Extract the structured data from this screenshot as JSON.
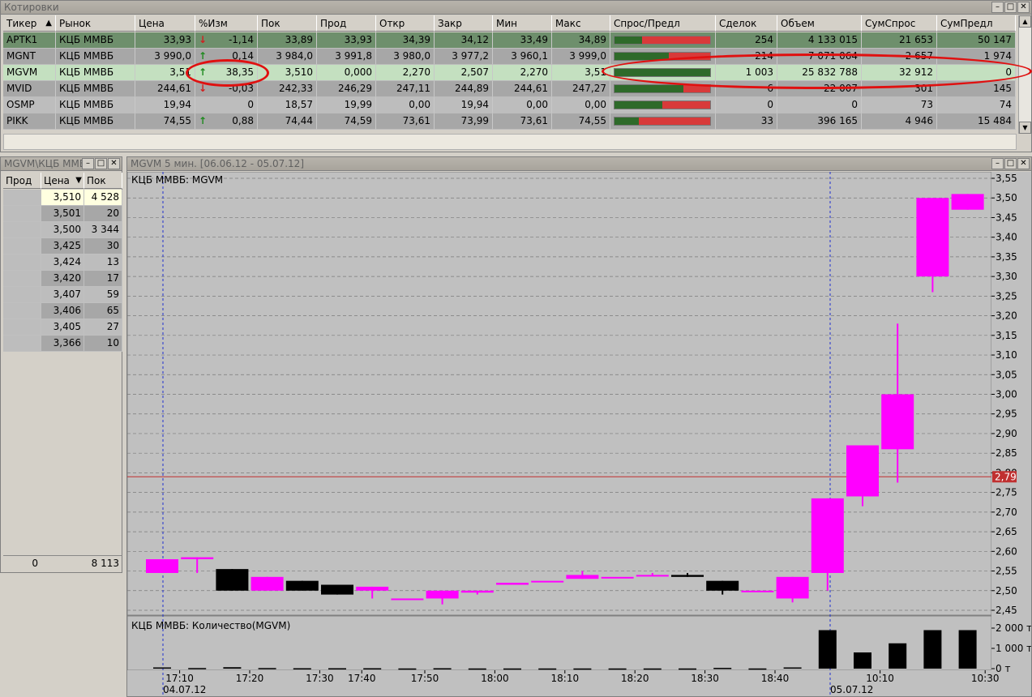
{
  "quotes": {
    "title": "Котировки",
    "columns": [
      "Тикер",
      "Рынок",
      "Цена",
      "%Изм",
      "Пок",
      "Прод",
      "Откр",
      "Закр",
      "Мин",
      "Макс",
      "Спрос/Предл",
      "Сделок",
      "Объем",
      "СумСпрос",
      "СумПредл"
    ],
    "sort_marker": "▲",
    "rows": [
      {
        "ticker": "APTK1",
        "market": "КЦБ ММВБ",
        "price": "33,93",
        "dir": "down",
        "chg": "-1,14",
        "bid": "33,89",
        "ask": "33,93",
        "open": "34,39",
        "close": "34,12",
        "min": "33,49",
        "max": "34,89",
        "bid_share": 0.29,
        "deals": "254",
        "volume": "4 133 015",
        "sum_bid": "21 653",
        "sum_ask": "50 147"
      },
      {
        "ticker": "MGNT",
        "market": "КЦБ ММВБ",
        "price": "3 990,0",
        "dir": "up",
        "chg": "0,14",
        "bid": "3 984,0",
        "ask": "3 991,8",
        "open": "3 980,0",
        "close": "3 977,2",
        "min": "3 960,1",
        "max": "3 999,0",
        "bid_share": 0.57,
        "deals": "214",
        "volume": "7 071 064",
        "sum_bid": "2 657",
        "sum_ask": "1 974"
      },
      {
        "ticker": "MGVM",
        "market": "КЦБ ММВБ",
        "price": "3,51",
        "dir": "up",
        "chg": "38,35",
        "bid": "3,510",
        "ask": "0,000",
        "open": "2,270",
        "close": "2,507",
        "min": "2,270",
        "max": "3,51",
        "bid_share": 1.0,
        "deals": "1 003",
        "volume": "25 832 788",
        "sum_bid": "32 912",
        "sum_ask": "0"
      },
      {
        "ticker": "MVID",
        "market": "КЦБ ММВБ",
        "price": "244,61",
        "dir": "down",
        "chg": "-0,03",
        "bid": "242,33",
        "ask": "246,29",
        "open": "247,11",
        "close": "244,89",
        "min": "244,61",
        "max": "247,27",
        "bid_share": 0.72,
        "deals": "6",
        "volume": "22 007",
        "sum_bid": "301",
        "sum_ask": "145"
      },
      {
        "ticker": "OSMP",
        "market": "КЦБ ММВБ",
        "price": "19,94",
        "dir": "none",
        "chg": "0",
        "bid": "18,57",
        "ask": "19,99",
        "open": "0,00",
        "close": "19,94",
        "min": "0,00",
        "max": "0,00",
        "bid_share": 0.5,
        "deals": "0",
        "volume": "0",
        "sum_bid": "73",
        "sum_ask": "74"
      },
      {
        "ticker": "PIKK",
        "market": "КЦБ ММВБ",
        "price": "74,55",
        "dir": "up",
        "chg": "0,88",
        "bid": "74,44",
        "ask": "74,59",
        "open": "73,61",
        "close": "73,99",
        "min": "73,61",
        "max": "74,55",
        "bid_share": 0.25,
        "deals": "33",
        "volume": "396 165",
        "sum_bid": "4 946",
        "sum_ask": "15 484"
      }
    ]
  },
  "book": {
    "title": "MGVM\\КЦБ ММВБ",
    "columns": [
      "Прод",
      "Цена",
      "Пок"
    ],
    "sort_marker": "▼",
    "rows": [
      {
        "ask": "",
        "price": "3,510",
        "bid": "4 528"
      },
      {
        "ask": "",
        "price": "3,501",
        "bid": "20"
      },
      {
        "ask": "",
        "price": "3,500",
        "bid": "3 344"
      },
      {
        "ask": "",
        "price": "3,425",
        "bid": "30"
      },
      {
        "ask": "",
        "price": "3,424",
        "bid": "13"
      },
      {
        "ask": "",
        "price": "3,420",
        "bid": "17"
      },
      {
        "ask": "",
        "price": "3,407",
        "bid": "59"
      },
      {
        "ask": "",
        "price": "3,406",
        "bid": "65"
      },
      {
        "ask": "",
        "price": "3,405",
        "bid": "27"
      },
      {
        "ask": "",
        "price": "3,366",
        "bid": "10"
      }
    ],
    "footer_ask": "0",
    "footer_bid": "8 113"
  },
  "chart_window": {
    "title": "MGVM  5 мин. [06.06.12 - 05.07.12]",
    "price_label": "КЦБ ММВБ: MGVM",
    "volume_label": "КЦБ ММВБ: Количество(MGVM)",
    "current_price_label": "2,79",
    "date_labels": [
      "04.07.12",
      "05.07.12"
    ],
    "volume_ticks": [
      "2 000 т",
      "1 000 т",
      "0 т"
    ]
  },
  "chart_data": {
    "type": "candlestick",
    "ylim": [
      2.45,
      3.55
    ],
    "price_ticks": [
      "3,55",
      "3,50",
      "3,45",
      "3,40",
      "3,35",
      "3,30",
      "3,25",
      "3,20",
      "3,15",
      "3,10",
      "3,05",
      "3,00",
      "2,95",
      "2,90",
      "2,85",
      "2,80",
      "2,75",
      "2,70",
      "2,65",
      "2,60",
      "2,55",
      "2,50",
      "2,45"
    ],
    "current_price": 2.79,
    "time_ticks": [
      {
        "label": "17:10",
        "index": 0.5
      },
      {
        "label": "17:20",
        "index": 2.5
      },
      {
        "label": "17:30",
        "index": 4.5
      },
      {
        "label": "17:40",
        "index": 5.7
      },
      {
        "label": "17:50",
        "index": 7.5
      },
      {
        "label": "18:00",
        "index": 9.5
      },
      {
        "label": "18:10",
        "index": 11.5
      },
      {
        "label": "18:20",
        "index": 13.5
      },
      {
        "label": "18:30",
        "index": 15.5
      },
      {
        "label": "18:40",
        "index": 17.5
      },
      {
        "label": "10:10",
        "index": 20.5
      },
      {
        "label": "10:30",
        "index": 23.5
      }
    ],
    "candles": [
      {
        "o": 2.545,
        "h": 2.58,
        "l": 2.545,
        "c": 2.58,
        "v": 60
      },
      {
        "o": 2.58,
        "h": 2.585,
        "l": 2.545,
        "c": 2.585,
        "v": 30
      },
      {
        "o": 2.555,
        "h": 2.555,
        "l": 2.5,
        "c": 2.5,
        "v": 70
      },
      {
        "o": 2.5,
        "h": 2.535,
        "l": 2.5,
        "c": 2.535,
        "v": 30
      },
      {
        "o": 2.525,
        "h": 2.525,
        "l": 2.5,
        "c": 2.5,
        "v": 20
      },
      {
        "o": 2.515,
        "h": 2.515,
        "l": 2.49,
        "c": 2.49,
        "v": 20
      },
      {
        "o": 2.5,
        "h": 2.51,
        "l": 2.48,
        "c": 2.51,
        "v": 20
      },
      {
        "o": 2.48,
        "h": 2.48,
        "l": 2.48,
        "c": 2.48,
        "v": 10
      },
      {
        "o": 2.48,
        "h": 2.5,
        "l": 2.465,
        "c": 2.5,
        "v": 20
      },
      {
        "o": 2.495,
        "h": 2.5,
        "l": 2.49,
        "c": 2.5,
        "v": 10
      },
      {
        "o": 2.515,
        "h": 2.52,
        "l": 2.515,
        "c": 2.52,
        "v": 10
      },
      {
        "o": 2.525,
        "h": 2.525,
        "l": 2.525,
        "c": 2.525,
        "v": 10
      },
      {
        "o": 2.53,
        "h": 2.55,
        "l": 2.53,
        "c": 2.54,
        "v": 10
      },
      {
        "o": 2.535,
        "h": 2.535,
        "l": 2.535,
        "c": 2.535,
        "v": 10
      },
      {
        "o": 2.54,
        "h": 2.545,
        "l": 2.54,
        "c": 2.54,
        "v": 10
      },
      {
        "o": 2.54,
        "h": 2.545,
        "l": 2.535,
        "c": 2.535,
        "v": 10
      },
      {
        "o": 2.525,
        "h": 2.525,
        "l": 2.49,
        "c": 2.5,
        "v": 40
      },
      {
        "o": 2.5,
        "h": 2.5,
        "l": 2.5,
        "c": 2.5,
        "v": 10
      },
      {
        "o": 2.48,
        "h": 2.535,
        "l": 2.47,
        "c": 2.535,
        "v": 60
      },
      {
        "o": 2.545,
        "h": 2.735,
        "l": 2.5,
        "c": 2.735,
        "v": 1900
      },
      {
        "o": 2.74,
        "h": 2.87,
        "l": 2.715,
        "c": 2.87,
        "v": 800
      },
      {
        "o": 2.86,
        "h": 3.18,
        "l": 2.775,
        "c": 3.0,
        "v": 1250
      },
      {
        "o": 3.3,
        "h": 3.5,
        "l": 3.26,
        "c": 3.5,
        "v": 1900
      },
      {
        "o": 3.47,
        "h": 3.51,
        "l": 3.47,
        "c": 3.51,
        "v": 1900
      }
    ],
    "volume_ylim": [
      0,
      2200
    ]
  }
}
